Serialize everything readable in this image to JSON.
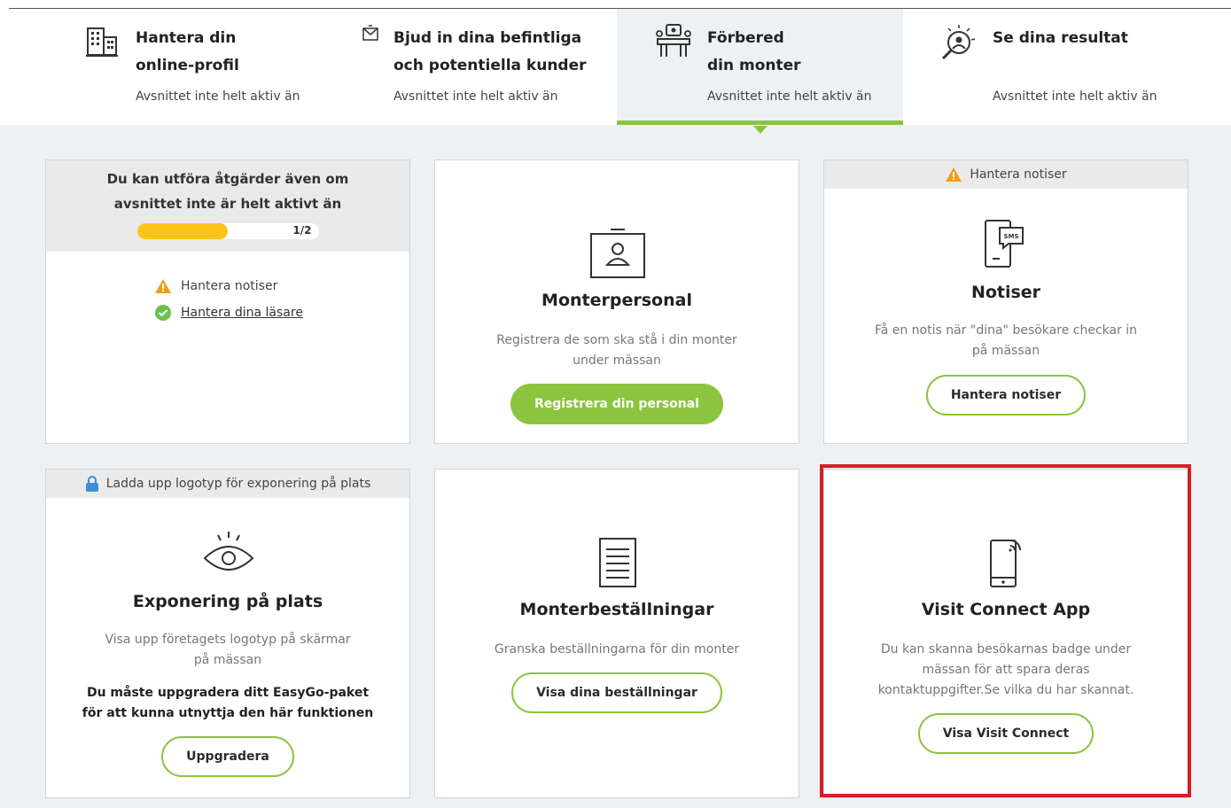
{
  "steps": [
    {
      "title_line1": "Hantera din",
      "title_line2": "online-profil",
      "status": "Avsnittet inte helt aktiv än",
      "icon": "building-icon"
    },
    {
      "title_line1": "Bjud in dina befintliga",
      "title_line2": "och potentiella kunder",
      "status": "Avsnittet inte helt aktiv än",
      "icon": "envelope-icon"
    },
    {
      "title_line1": "Förbered",
      "title_line2": "din monter",
      "status": "Avsnittet inte helt aktiv än",
      "icon": "booth-icon",
      "active": true
    },
    {
      "title_line1": "Se dina resultat",
      "title_line2": "",
      "status": "Avsnittet inte helt aktiv än",
      "icon": "magnifier-people-icon"
    }
  ],
  "summary": {
    "heading": "Du kan utföra åtgärder även om avsnittet inte är helt aktivt än",
    "progress_label": "1/2",
    "progress_fraction": 0.5,
    "items": [
      {
        "label": "Hantera notiser",
        "state": "warning"
      },
      {
        "label": "Hantera dina läsare",
        "state": "done"
      }
    ]
  },
  "cards": {
    "personal": {
      "title": "Monterpersonal",
      "description": "Registrera de som ska stå i din monter under mässan",
      "button": "Registrera din personal"
    },
    "notiser": {
      "header": "Hantera notiser",
      "title": "Notiser",
      "description": "Få en notis när \"dina\" besökare checkar in på mässan",
      "button": "Hantera notiser",
      "sms_label": "SMS"
    },
    "exponering": {
      "header": "Ladda upp logotyp för exponering på plats",
      "title": "Exponering på plats",
      "description": "Visa upp företagets logotyp på skärmar på mässan",
      "notice": "Du måste uppgradera ditt EasyGo-paket för att kunna utnyttja den här funktionen",
      "button": "Uppgradera"
    },
    "bestallningar": {
      "title": "Monterbeställningar",
      "description": "Granska beställningarna för din monter",
      "button": "Visa dina beställningar"
    },
    "visit": {
      "title": "Visit Connect App",
      "description": "Du kan skanna besökarnas badge under mässan för att spara deras kontaktuppgifter.Se vilka du har skannat.",
      "button": "Visa Visit Connect"
    }
  },
  "colors": {
    "accent": "#8bc53f",
    "warning": "#f39c12",
    "progress": "#fcc419",
    "success": "#6cc04a",
    "highlight": "#d51f26",
    "lock": "#3b8fd9"
  }
}
